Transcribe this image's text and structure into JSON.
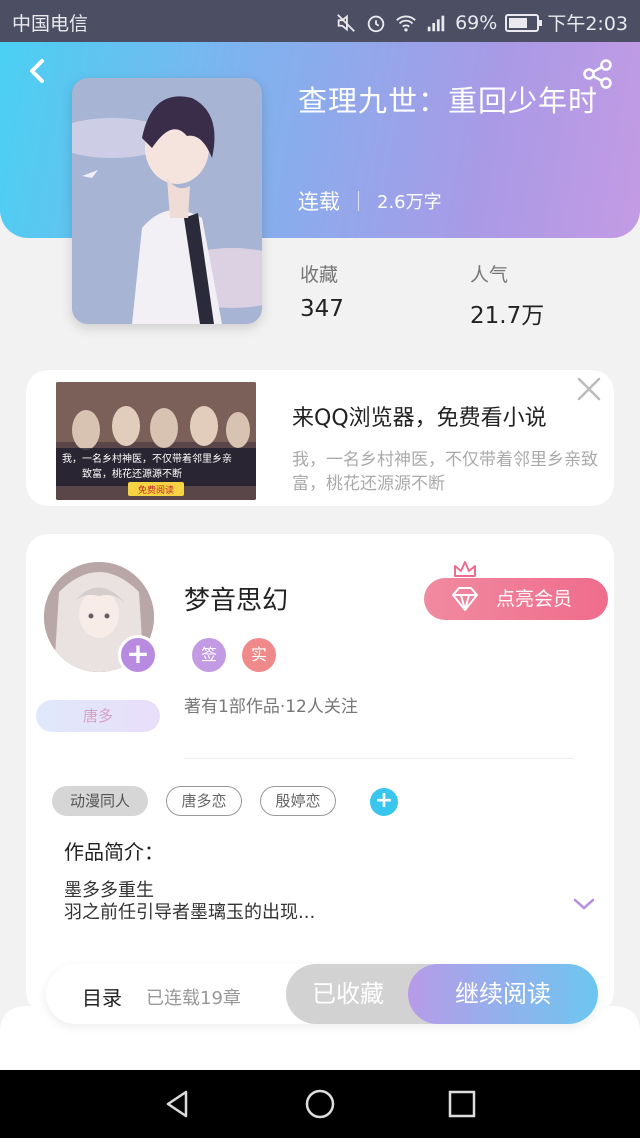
{
  "status_bar": {
    "carrier": "中国电信",
    "battery": "69%",
    "battery_level": 0.69,
    "time": "下午2:03",
    "network": "26"
  },
  "book": {
    "title": "查理九世：重回少年时",
    "status": "连载",
    "word_count": "2.6万字",
    "stats": [
      {
        "label": "收藏",
        "value": "347"
      },
      {
        "label": "人气",
        "value": "21.7万"
      }
    ]
  },
  "ad": {
    "title": "来QQ浏览器，免费看小说",
    "description": "我，一名乡村神医，不仅带着邻里乡亲致富，桃花还源源不断",
    "image_lines": [
      "我，一名乡村神医，不仅带着邻里乡亲",
      "致富，桃花还源源不断"
    ],
    "image_button": "免费阅读"
  },
  "author": {
    "name": "梦音思幻",
    "badge_sign": "签",
    "badge_real": "实",
    "vip_label": "点亮会员",
    "stats_text": "著有1部作品·12人关注",
    "level_tag": "唐多"
  },
  "tags": [
    "动漫同人",
    "唐多恋",
    "殷婷恋"
  ],
  "intro": {
    "heading": "作品简介：",
    "line1": "墨多多重生",
    "line2": "羽之前任引导者墨璃玉的出现..."
  },
  "bottom_bar": {
    "toc_label": "目录",
    "chapters_label": "已连载19章",
    "fav_label": "已收藏",
    "read_label": "继续阅读"
  },
  "colors": {
    "header_start": "#4ad0f2",
    "header_end": "#c49be4",
    "vip": "#f06c8c",
    "accent_cyan": "#38c6ef",
    "accent_purple": "#b88be0"
  }
}
